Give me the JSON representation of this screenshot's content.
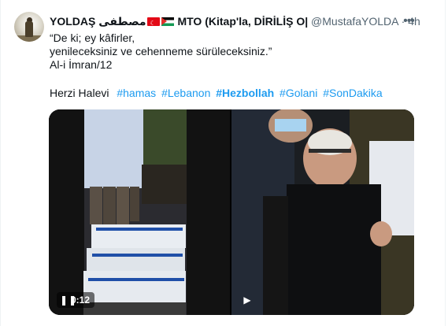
{
  "author": {
    "display_name": "YOLDAŞ",
    "arabic_name": "مصطفى",
    "name_suffix": "MTO (Kitap'la, DİRİLİŞ O|",
    "handle": "@MustafaYOLDA",
    "separator": "·",
    "timestamp": "4h"
  },
  "tweet": {
    "lines": [
      "“De ki; ey kâfirler,",
      "yenileceksiniz ve cehenneme sürüleceksiniz.”",
      "Al-i İmran/12"
    ],
    "author_line": "Herzi Halevi",
    "hashtags": [
      {
        "text": "#hamas",
        "bold": false
      },
      {
        "text": "#Lebanon",
        "bold": false
      },
      {
        "text": "#Hezbollah",
        "bold": true
      },
      {
        "text": "#Golani",
        "bold": false
      },
      {
        "text": "#SonDakika",
        "bold": false
      }
    ]
  },
  "media": {
    "left_video_time": "0:12",
    "left_video_icon": "pause-icon",
    "right_video_icon": "play-icon"
  },
  "icons": {
    "more": "more-options-icon"
  },
  "colors": {
    "link": "#1d9bf0",
    "secondary_text": "#536471",
    "primary_text": "#0f1419"
  }
}
